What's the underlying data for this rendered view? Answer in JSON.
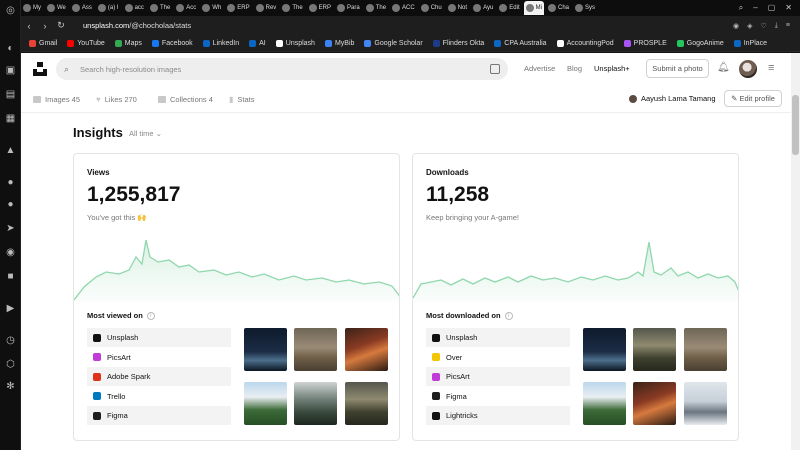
{
  "browser": {
    "tabs": [
      "My",
      "We",
      "Ass",
      "(a) I",
      "acc",
      "The",
      "Acc",
      "Wh",
      "ERP",
      "Rev",
      "The",
      "ERP",
      "Para",
      "The",
      "ACC",
      "Chu",
      "Not",
      "Ayu",
      "Edit",
      "Mi",
      "Cha",
      "Sys"
    ],
    "active_tab_index": 19,
    "url_host": "unsplash.com",
    "url_path": "/@chocholaa/stats",
    "bookmarks": [
      {
        "label": "Gmail",
        "color": "#ea4335"
      },
      {
        "label": "YouTube",
        "color": "#ff0000"
      },
      {
        "label": "Maps",
        "color": "#34a853"
      },
      {
        "label": "Facebook",
        "color": "#1877f2"
      },
      {
        "label": "LinkedIn",
        "color": "#0a66c2"
      },
      {
        "label": "AI",
        "color": "#0a66c2"
      },
      {
        "label": "Unsplash",
        "color": "#ffffff"
      },
      {
        "label": "MyBib",
        "color": "#3b82f6"
      },
      {
        "label": "Google Scholar",
        "color": "#4285f4"
      },
      {
        "label": "Flinders Okta",
        "color": "#1e3a8a"
      },
      {
        "label": "CPA Australia",
        "color": "#0a66c2"
      },
      {
        "label": "AccountingPod",
        "color": "#ffffff"
      },
      {
        "label": "PROSPLE",
        "color": "#a855f7"
      },
      {
        "label": "GogoAnime",
        "color": "#22c55e"
      },
      {
        "label": "InPlace",
        "color": "#0a66c2"
      }
    ]
  },
  "header": {
    "search_placeholder": "Search high-resolution images",
    "advertise": "Advertise",
    "blog": "Blog",
    "unsplash_plus": "Unsplash+",
    "submit_photo": "Submit a photo"
  },
  "subnav": {
    "images": "Images 45",
    "likes": "Likes 270",
    "collections": "Collections 4",
    "stats": "Stats",
    "user_name": "Aayush Lama Tamang",
    "edit_profile": "Edit profile"
  },
  "insights": {
    "title": "Insights",
    "range": "All time"
  },
  "views": {
    "label": "Views",
    "value": "1,255,817",
    "message": "You've got this 🙌",
    "most_title": "Most viewed on",
    "platforms": [
      {
        "name": "Unsplash",
        "color": "#111111"
      },
      {
        "name": "PicsArt",
        "color": "#c13bd8"
      },
      {
        "name": "Adobe Spark",
        "color": "#e0311a"
      },
      {
        "name": "Trello",
        "color": "#0079bf"
      },
      {
        "name": "Figma",
        "color": "#1e1e1e"
      }
    ]
  },
  "downloads": {
    "label": "Downloads",
    "value": "11,258",
    "message": "Keep bringing your A-game!",
    "most_title": "Most downloaded on",
    "platforms": [
      {
        "name": "Unsplash",
        "color": "#111111"
      },
      {
        "name": "Over",
        "color": "#f2c500"
      },
      {
        "name": "PicsArt",
        "color": "#c13bd8"
      },
      {
        "name": "Figma",
        "color": "#1e1e1e"
      },
      {
        "name": "Lightricks",
        "color": "#111111"
      }
    ]
  }
}
